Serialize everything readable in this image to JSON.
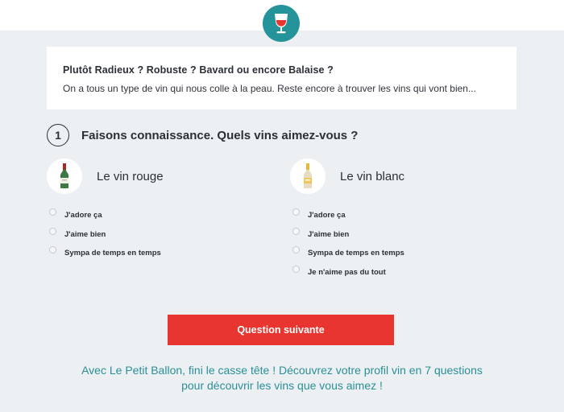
{
  "header": {
    "logo_icon": "wine-glass-icon",
    "accent_color": "#24939a"
  },
  "intro": {
    "title": "Plutôt Radieux ? Robuste ? Bavard ou encore Balaise ?",
    "text": "On a tous un type de vin qui nous colle à la peau. Reste encore à trouver les vins qui vont bien..."
  },
  "step": {
    "number": "1",
    "title": "Faisons connaissance. Quels vins aimez-vous ?"
  },
  "red_wine": {
    "icon": "red-wine-bottle-icon",
    "title": "Le vin rouge",
    "options": [
      "J'adore ça",
      "J'aime bien",
      "Sympa de temps en temps"
    ]
  },
  "white_wine": {
    "icon": "white-wine-bottle-icon",
    "title": "Le vin blanc",
    "options": [
      "J'adore ça",
      "J'aime bien",
      "Sympa de temps en temps",
      "Je n'aime pas du tout"
    ]
  },
  "cta": {
    "label": "Question suivante",
    "color": "#e8352f"
  },
  "footer": {
    "line1": "Avec Le Petit Ballon, fini le casse tête ! Découvrez votre profil vin en 7 questions",
    "line2": "pour découvrir les vins que vous aimez !"
  }
}
